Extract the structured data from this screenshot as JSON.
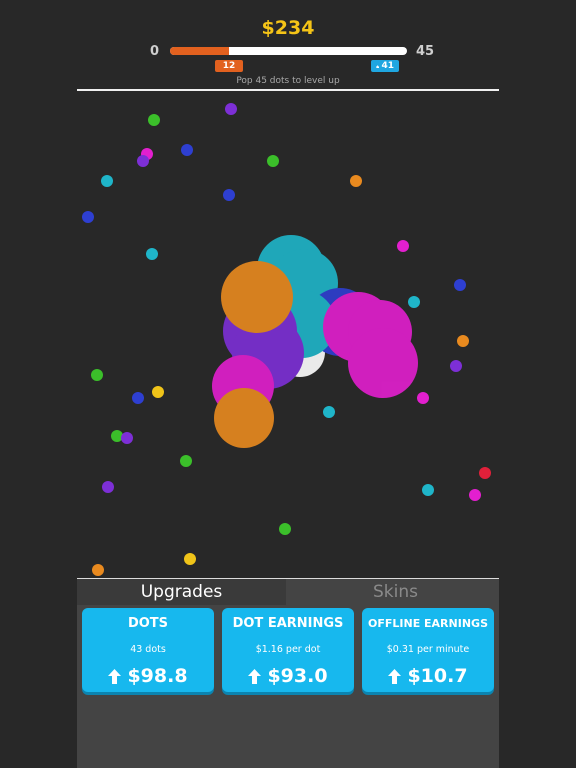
{
  "hud": {
    "money": "$234",
    "level_min": "0",
    "level_max": "45",
    "progress_fraction": 0.25,
    "current_count": "12",
    "target_count": "41",
    "hint": "Pop 45 dots to level up"
  },
  "tabs": [
    {
      "label": "Upgrades",
      "active": true
    },
    {
      "label": "Skins",
      "active": false
    }
  ],
  "upgrades": [
    {
      "title": "DOTS",
      "subtitle": "43 dots",
      "price": "$98.8"
    },
    {
      "title": "DOT EARNINGS",
      "subtitle": "$1.16 per dot",
      "price": "$93.0"
    },
    {
      "title": "OFFLINE EARNINGS",
      "subtitle": "$0.31 per minute",
      "price": "$10.7"
    }
  ],
  "colors": {
    "money": "#f5c417",
    "progress": "#e2611f",
    "target_badge": "#1fa6e0",
    "card": "#17b8ee",
    "dot_palette": [
      "#1fb5c9",
      "#e31fcf",
      "#7d2fd6",
      "#2e3fd1",
      "#e98a1f",
      "#3bbf2a",
      "#f0c419",
      "#e0203a"
    ]
  },
  "icons": {
    "crown": "crown-icon",
    "upgrade_arrow": "arrow-up-icon"
  }
}
